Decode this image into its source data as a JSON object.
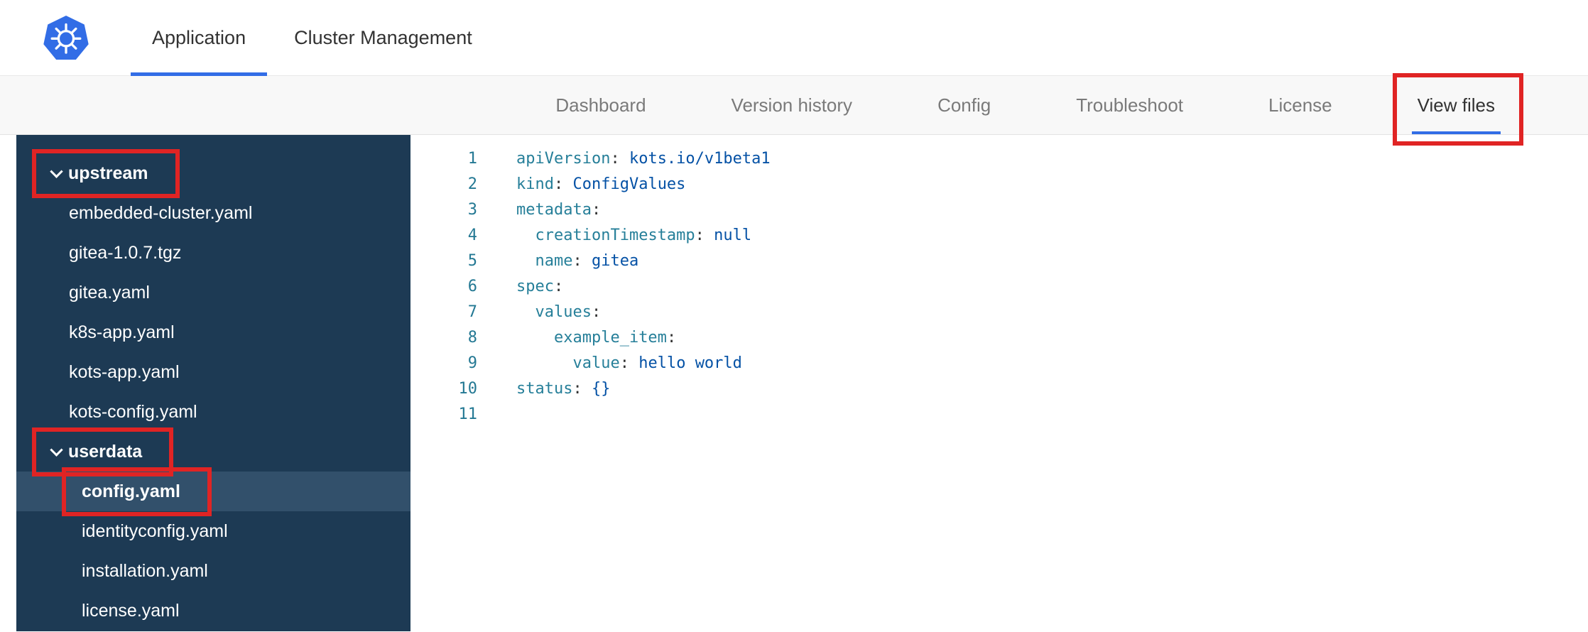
{
  "topbar": {
    "tabs": [
      {
        "label": "Application",
        "active": true
      },
      {
        "label": "Cluster Management",
        "active": false
      }
    ]
  },
  "subnav": {
    "tabs": [
      {
        "label": "Dashboard",
        "active": false,
        "annotated": false
      },
      {
        "label": "Version history",
        "active": false,
        "annotated": false
      },
      {
        "label": "Config",
        "active": false,
        "annotated": false
      },
      {
        "label": "Troubleshoot",
        "active": false,
        "annotated": false
      },
      {
        "label": "License",
        "active": false,
        "annotated": false
      },
      {
        "label": "View files",
        "active": true,
        "annotated": true
      }
    ]
  },
  "file_tree": {
    "items": [
      {
        "label": "upstream",
        "kind": "folder",
        "depth": 0,
        "expanded": true,
        "selected": false,
        "annotated": true
      },
      {
        "label": "embedded-cluster.yaml",
        "kind": "file",
        "depth": 1,
        "selected": false,
        "annotated": false
      },
      {
        "label": "gitea-1.0.7.tgz",
        "kind": "file",
        "depth": 1,
        "selected": false,
        "annotated": false
      },
      {
        "label": "gitea.yaml",
        "kind": "file",
        "depth": 1,
        "selected": false,
        "annotated": false
      },
      {
        "label": "k8s-app.yaml",
        "kind": "file",
        "depth": 1,
        "selected": false,
        "annotated": false
      },
      {
        "label": "kots-app.yaml",
        "kind": "file",
        "depth": 1,
        "selected": false,
        "annotated": false
      },
      {
        "label": "kots-config.yaml",
        "kind": "file",
        "depth": 1,
        "selected": false,
        "annotated": false
      },
      {
        "label": "userdata",
        "kind": "folder",
        "depth": 1,
        "expanded": true,
        "selected": false,
        "annotated": true
      },
      {
        "label": "config.yaml",
        "kind": "file",
        "depth": 2,
        "selected": true,
        "annotated": true
      },
      {
        "label": "identityconfig.yaml",
        "kind": "file",
        "depth": 2,
        "selected": false,
        "annotated": false
      },
      {
        "label": "installation.yaml",
        "kind": "file",
        "depth": 2,
        "selected": false,
        "annotated": false
      },
      {
        "label": "license.yaml",
        "kind": "file",
        "depth": 2,
        "selected": false,
        "annotated": false
      }
    ]
  },
  "editor": {
    "language": "yaml",
    "lines": [
      {
        "num": 1,
        "tokens": [
          [
            "key",
            "apiVersion"
          ],
          [
            "punct",
            ": "
          ],
          [
            "value",
            "kots.io/v1beta1"
          ]
        ]
      },
      {
        "num": 2,
        "tokens": [
          [
            "key",
            "kind"
          ],
          [
            "punct",
            ": "
          ],
          [
            "value",
            "ConfigValues"
          ]
        ]
      },
      {
        "num": 3,
        "tokens": [
          [
            "key",
            "metadata"
          ],
          [
            "punct",
            ":"
          ]
        ]
      },
      {
        "num": 4,
        "tokens": [
          [
            "plain",
            "  "
          ],
          [
            "key",
            "creationTimestamp"
          ],
          [
            "punct",
            ": "
          ],
          [
            "value",
            "null"
          ]
        ]
      },
      {
        "num": 5,
        "tokens": [
          [
            "plain",
            "  "
          ],
          [
            "key",
            "name"
          ],
          [
            "punct",
            ": "
          ],
          [
            "value",
            "gitea"
          ]
        ]
      },
      {
        "num": 6,
        "tokens": [
          [
            "key",
            "spec"
          ],
          [
            "punct",
            ":"
          ]
        ]
      },
      {
        "num": 7,
        "tokens": [
          [
            "plain",
            "  "
          ],
          [
            "key",
            "values"
          ],
          [
            "punct",
            ":"
          ]
        ]
      },
      {
        "num": 8,
        "tokens": [
          [
            "plain",
            "    "
          ],
          [
            "key",
            "example_item"
          ],
          [
            "punct",
            ":"
          ]
        ]
      },
      {
        "num": 9,
        "tokens": [
          [
            "plain",
            "      "
          ],
          [
            "key",
            "value"
          ],
          [
            "punct",
            ": "
          ],
          [
            "value",
            "hello world"
          ]
        ]
      },
      {
        "num": 10,
        "tokens": [
          [
            "key",
            "status"
          ],
          [
            "punct",
            ": "
          ],
          [
            "value",
            "{}"
          ]
        ]
      },
      {
        "num": 11,
        "tokens": []
      }
    ]
  },
  "colors": {
    "accent_blue": "#326de6",
    "annotation_red": "#e02424",
    "sidebar_bg": "#1d3a54",
    "selected_row_bg": "#32506b",
    "code_key": "#267f99",
    "code_value": "#0451a5",
    "line_number": "#237893"
  }
}
